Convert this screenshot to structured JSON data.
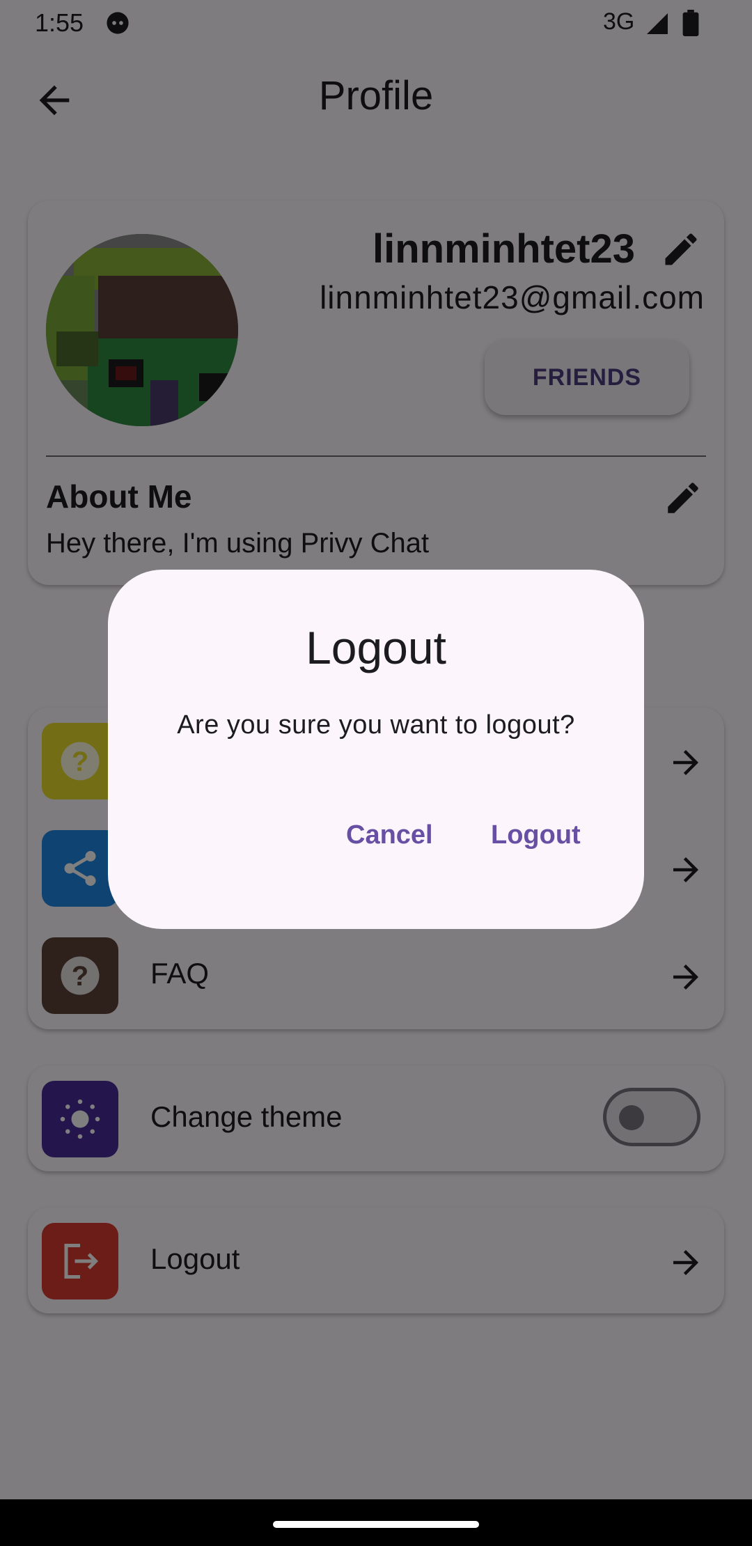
{
  "status_bar": {
    "time": "1:55",
    "network": "3G"
  },
  "app_bar": {
    "title": "Profile"
  },
  "profile": {
    "username": "linnminhtet23",
    "email": "linnminhtet23@gmail.com",
    "friends_button": "FRIENDS",
    "about_title": "About Me",
    "about_text": "Hey there, I'm using Privy Chat"
  },
  "menu": {
    "items": [
      {
        "label": "",
        "icon": "help-icon",
        "color": "#e6dc2a"
      },
      {
        "label": "",
        "icon": "share-icon",
        "color": "#1e88e5"
      },
      {
        "label": "FAQ",
        "icon": "help-icon",
        "color": "#5d4037"
      }
    ]
  },
  "theme": {
    "label": "Change theme",
    "icon": "sun-icon",
    "color": "#4a2a9a",
    "enabled": false
  },
  "logout_row": {
    "label": "Logout",
    "icon": "logout-icon",
    "color": "#d93a2f"
  },
  "dialog": {
    "title": "Logout",
    "message": "Are you sure you want to logout?",
    "cancel": "Cancel",
    "confirm": "Logout"
  }
}
